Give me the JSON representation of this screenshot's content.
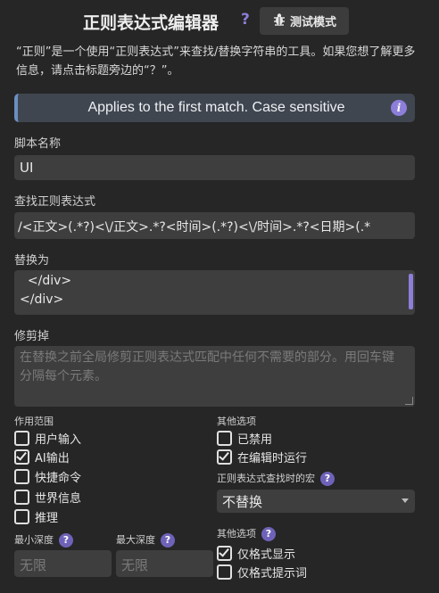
{
  "header": {
    "title": "正则表达式编辑器",
    "help": "?",
    "test_mode_label": "测试模式"
  },
  "description": "“正则”是一个使用“正则表达式”来查找/替换字符串的工具。如果您想了解更多信息，请点击标题旁边的“？”。",
  "info_banner": {
    "text": "Applies to the first match. Case sensitive",
    "icon": "info-icon"
  },
  "script_name": {
    "label": "脚本名称",
    "value": "UI"
  },
  "find_regex": {
    "label": "查找正则表达式",
    "value": "/<正文>(.*?)<\\/正文>.*?<时间>(.*?)<\\/时间>.*?<日期>(.*"
  },
  "replace": {
    "label": "替换为",
    "lines": [
      "  </div>",
      "</div>"
    ]
  },
  "trim": {
    "label": "修剪掉",
    "placeholder": "在替换之前全局修剪正则表达式匹配中任何不需要的部分。用回车键分隔每个元素。"
  },
  "scope": {
    "label": "作用范围",
    "items": [
      {
        "label": "用户输入",
        "checked": false
      },
      {
        "label": "AI输出",
        "checked": true
      },
      {
        "label": "快捷命令",
        "checked": false
      },
      {
        "label": "世界信息",
        "checked": false
      },
      {
        "label": "推理",
        "checked": false
      }
    ]
  },
  "other_options": {
    "label": "其他选项",
    "items": [
      {
        "label": "已禁用",
        "checked": false
      },
      {
        "label": "在编辑时运行",
        "checked": true
      }
    ]
  },
  "macro": {
    "label": "正则表达式查找时的宏",
    "value": "不替换"
  },
  "depth": {
    "min_label": "最小深度",
    "max_label": "最大深度",
    "min_placeholder": "无限",
    "max_placeholder": "无限"
  },
  "other_options_2": {
    "label": "其他选项",
    "items": [
      {
        "label": "仅格式显示",
        "checked": true
      },
      {
        "label": "仅格式提示词",
        "checked": false
      }
    ]
  },
  "colors": {
    "accent": "#8c7ed9",
    "banner_border": "#6b8fc2",
    "background": "#262626",
    "field": "#3e3e3e"
  }
}
